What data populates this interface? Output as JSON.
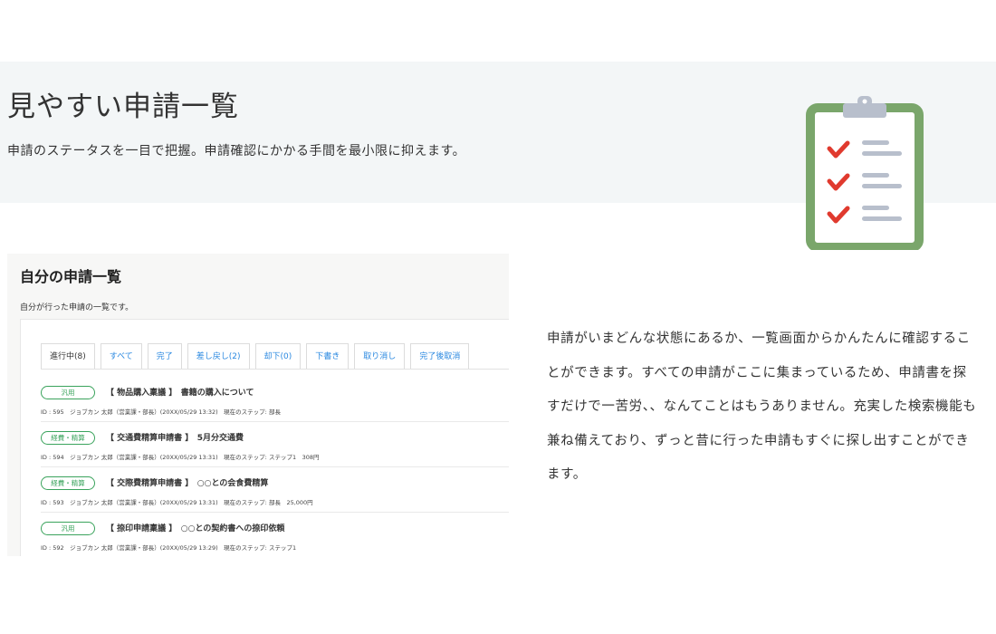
{
  "hero": {
    "title": "見やすい申請一覧",
    "subtitle": "申請のステータスを一目で把握。申請確認にかかる手間を最小限に抑えます。"
  },
  "screenshot": {
    "title": "自分の申請一覧",
    "subtitle": "自分が行った申請の一覧です。",
    "tabs": [
      {
        "label": "進行中(8)",
        "active": true
      },
      {
        "label": "すべて",
        "active": false
      },
      {
        "label": "完了",
        "active": false
      },
      {
        "label": "差し戻し(2)",
        "active": false
      },
      {
        "label": "却下(0)",
        "active": false
      },
      {
        "label": "下書き",
        "active": false
      },
      {
        "label": "取り消し",
        "active": false
      },
      {
        "label": "完了後取消",
        "active": false
      }
    ],
    "items": [
      {
        "badge": "汎用",
        "title": "【 物品購入稟議 】　書籍の購入について",
        "meta": "ID : 595　ジョブカン 太郎（営業課・部長）(20XX/05/29 13:32)　現在のステップ: 部長"
      },
      {
        "badge": "経費・精算",
        "title": "【 交通費精算申請書 】　5月分交通費",
        "meta": "ID : 594　ジョブカン 太郎（営業課・部長）(20XX/05/29 13:31)　現在のステップ: ステップ1　308円"
      },
      {
        "badge": "経費・精算",
        "title": "【 交際費精算申請書 】　○○との会食費精算",
        "meta": "ID : 593　ジョブカン 太郎（営業課・部長）(20XX/05/29 13:31)　現在のステップ: 部長　25,000円"
      },
      {
        "badge": "汎用",
        "title": "【 捺印申請稟議 】　○○との契約書への捺印依頼",
        "meta": "ID : 592　ジョブカン 太郎（営業課・部長）(20XX/05/29 13:29)　現在のステップ: ステップ1"
      }
    ]
  },
  "description": "申請がいまどんな状態にあるか、一覧画面からかんたんに確認することができます。すべての申請がここに集まっているため、申請書を探すだけで一苦労、、なんてことはもうありません。充実した検索機能も兼ね備えており、ずっと昔に行った申請もすぐに探し出すことができます。",
  "icons": {
    "clipboard": "clipboard-checklist-icon"
  },
  "colors": {
    "accent_green": "#3aa35c",
    "tab_blue": "#2a88e0",
    "clipboard_border": "#7aa66b",
    "check_red": "#e03a2e"
  }
}
